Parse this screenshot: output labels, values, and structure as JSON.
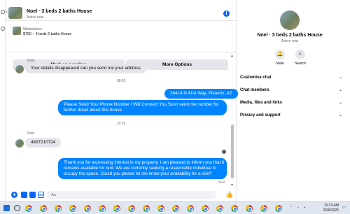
{
  "chat_header": {
    "title": "Noel · 3 beds 2 baths House",
    "subtitle": "Active now"
  },
  "marketplace": {
    "label": "Marketplace",
    "item": "$750 – 3 beds 2 baths House",
    "mark_pending_label": "Mark as pending",
    "more_options_label": "More Options"
  },
  "messages": {
    "sender_name_1": "Noel",
    "msg_1": "Your details disappeared can you send me your address",
    "time_1": "08:05",
    "msg_2": "26414 N 41st Way, Phoenix, AZ",
    "msg_3_line1": "Please Send Your Phone Number I Will Connect You Soon       send me number for",
    "msg_3_line2": "further detail about this house",
    "time_2": "10:16",
    "sender_name_2": "Noel",
    "msg_4": "4807210724",
    "msg_5_lines": [
      "Thank you for expressing interest in my property. I am pleased to inform you that it",
      "remains available for rent. We are currently seeking a responsible individual to",
      "occupy the space. Could you please let me know your availability for a visit?"
    ],
    "sent_label": "Sent"
  },
  "composer": {
    "placeholder": "Aa"
  },
  "panel": {
    "name": "Noel · 3 beds 2 baths House",
    "status": "Active now",
    "mute_label": "Mute",
    "search_label": "Search",
    "sections": [
      "Customise chat",
      "Chat members",
      "Media, files and links",
      "Privacy and support"
    ]
  },
  "taskbar": {
    "time": "10:23 AM",
    "date": "3/26/2025",
    "app_count": 18
  },
  "colors": {
    "accent": "#0866ff",
    "outgoing_bubble": "#0084ff",
    "incoming_bubble": "#e4e6eb",
    "taskbar": "#dfe6ef"
  }
}
